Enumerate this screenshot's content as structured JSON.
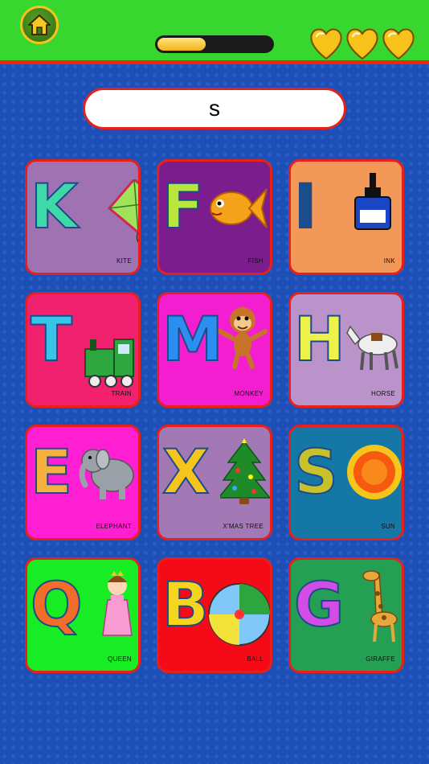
{
  "topbar": {
    "home_icon": "house-icon",
    "progress": 0.42,
    "lives": 3,
    "heart_color": "#f7c31a"
  },
  "target": {
    "letter": "s"
  },
  "tiles": [
    {
      "letter": "K",
      "word": "KITE",
      "bg": "#9f72b2",
      "letter_color": "#3ed8a9",
      "icon": "kite-icon"
    },
    {
      "letter": "F",
      "word": "FISH",
      "bg": "#7b1d8c",
      "letter_color": "#b9e63b",
      "icon": "fish-icon"
    },
    {
      "letter": "I",
      "word": "INK",
      "bg": "#f2995a",
      "letter_color": "#1a4d8a",
      "icon": "ink-bottle-icon"
    },
    {
      "letter": "T",
      "word": "TRAIN",
      "bg": "#f2216d",
      "letter_color": "#3ac3e9",
      "icon": "train-icon"
    },
    {
      "letter": "M",
      "word": "MONKEY",
      "bg": "#f41ed1",
      "letter_color": "#2c8ef0",
      "icon": "monkey-icon"
    },
    {
      "letter": "H",
      "word": "HORSE",
      "bg": "#b993c9",
      "letter_color": "#ecf24a",
      "icon": "horse-icon"
    },
    {
      "letter": "E",
      "word": "ELEPHANT",
      "bg": "#ff1fd2",
      "letter_color": "#f6b03e",
      "icon": "elephant-icon"
    },
    {
      "letter": "X",
      "word": "X'MAS TREE",
      "bg": "#a279b5",
      "letter_color": "#f5c51c",
      "icon": "christmas-tree-icon"
    },
    {
      "letter": "S",
      "word": "SUN",
      "bg": "#1577a5",
      "letter_color": "#c7c22b",
      "icon": "sun-icon"
    },
    {
      "letter": "Q",
      "word": "QUEEN",
      "bg": "#17ec24",
      "letter_color": "#f36d2a",
      "icon": "queen-icon"
    },
    {
      "letter": "B",
      "word": "BALL",
      "bg": "#f40b17",
      "letter_color": "#f5d51d",
      "icon": "ball-icon"
    },
    {
      "letter": "G",
      "word": "GIRAFFE",
      "bg": "#249f53",
      "letter_color": "#d24de6",
      "icon": "giraffe-icon"
    }
  ]
}
